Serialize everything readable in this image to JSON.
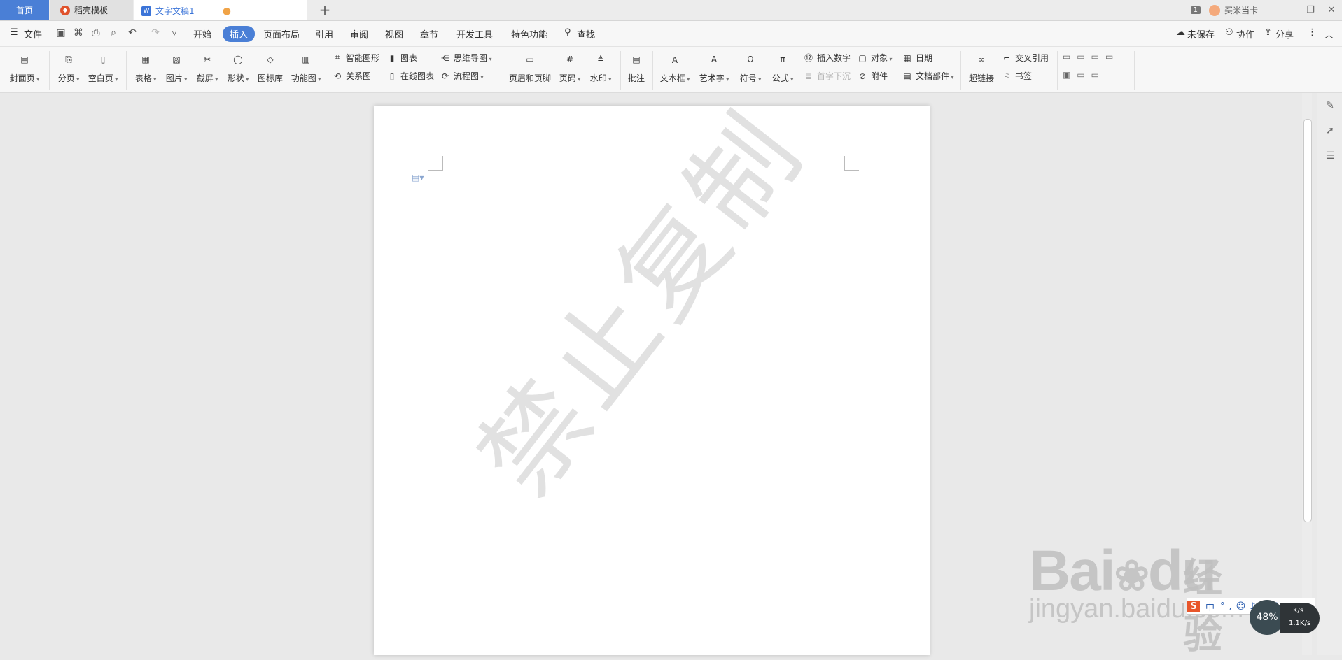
{
  "titlebar": {
    "tabs": [
      {
        "label": "首页"
      },
      {
        "label": "稻壳模板"
      },
      {
        "label": "文字文稿1"
      }
    ],
    "add_tab": "+",
    "notify_count": "1",
    "user_name": "买米当卡",
    "window_buttons": [
      "—",
      "❐",
      "✕"
    ]
  },
  "menubar": {
    "file": "文件",
    "items": [
      "开始",
      "插入",
      "页面布局",
      "引用",
      "审阅",
      "视图",
      "章节",
      "开发工具",
      "特色功能"
    ],
    "search": "查找",
    "right": {
      "unsaved": "未保存",
      "collab": "协作",
      "share": "分享"
    }
  },
  "ribbon": {
    "cover": "封面页",
    "page_break": "分页",
    "blank_page": "空白页",
    "table": "表格",
    "picture": "图片",
    "screenshot": "截屏",
    "shape": "形状",
    "icon_lib": "图标库",
    "func_chart": "功能图",
    "smart_shape": "智能图形",
    "chart": "图表",
    "mindmap": "思维导图",
    "relation": "关系图",
    "online_chart": "在线图表",
    "flowchart": "流程图",
    "header_footer": "页眉和页脚",
    "page_num": "页码",
    "watermark": "水印",
    "comment": "批注",
    "textbox": "文本框",
    "wordart": "艺术字",
    "symbol": "符号",
    "formula": "公式",
    "insert_number": "插入数字",
    "drop_cap": "首字下沉",
    "object": "对象",
    "attachment": "附件",
    "date": "日期",
    "doc_parts": "文档部件",
    "hyperlink": "超链接",
    "cross_ref": "交叉引用",
    "bookmark": "书签"
  },
  "document": {
    "watermark_text": "禁止复制"
  },
  "overlay": {
    "baidu_logo": "Bai",
    "baidu_du": "du",
    "baidu_cn": "经验",
    "baidu_url": "jingyan.baidu.com",
    "ime_lang": "中",
    "net_percent": "48%",
    "net_speed_up": "K/s",
    "net_speed_down": "1.1K/s"
  },
  "colors": {
    "accent": "#4a7fd6",
    "doc_tab_text": "#3b74d8",
    "unsaved_dot": "#f0a347"
  }
}
